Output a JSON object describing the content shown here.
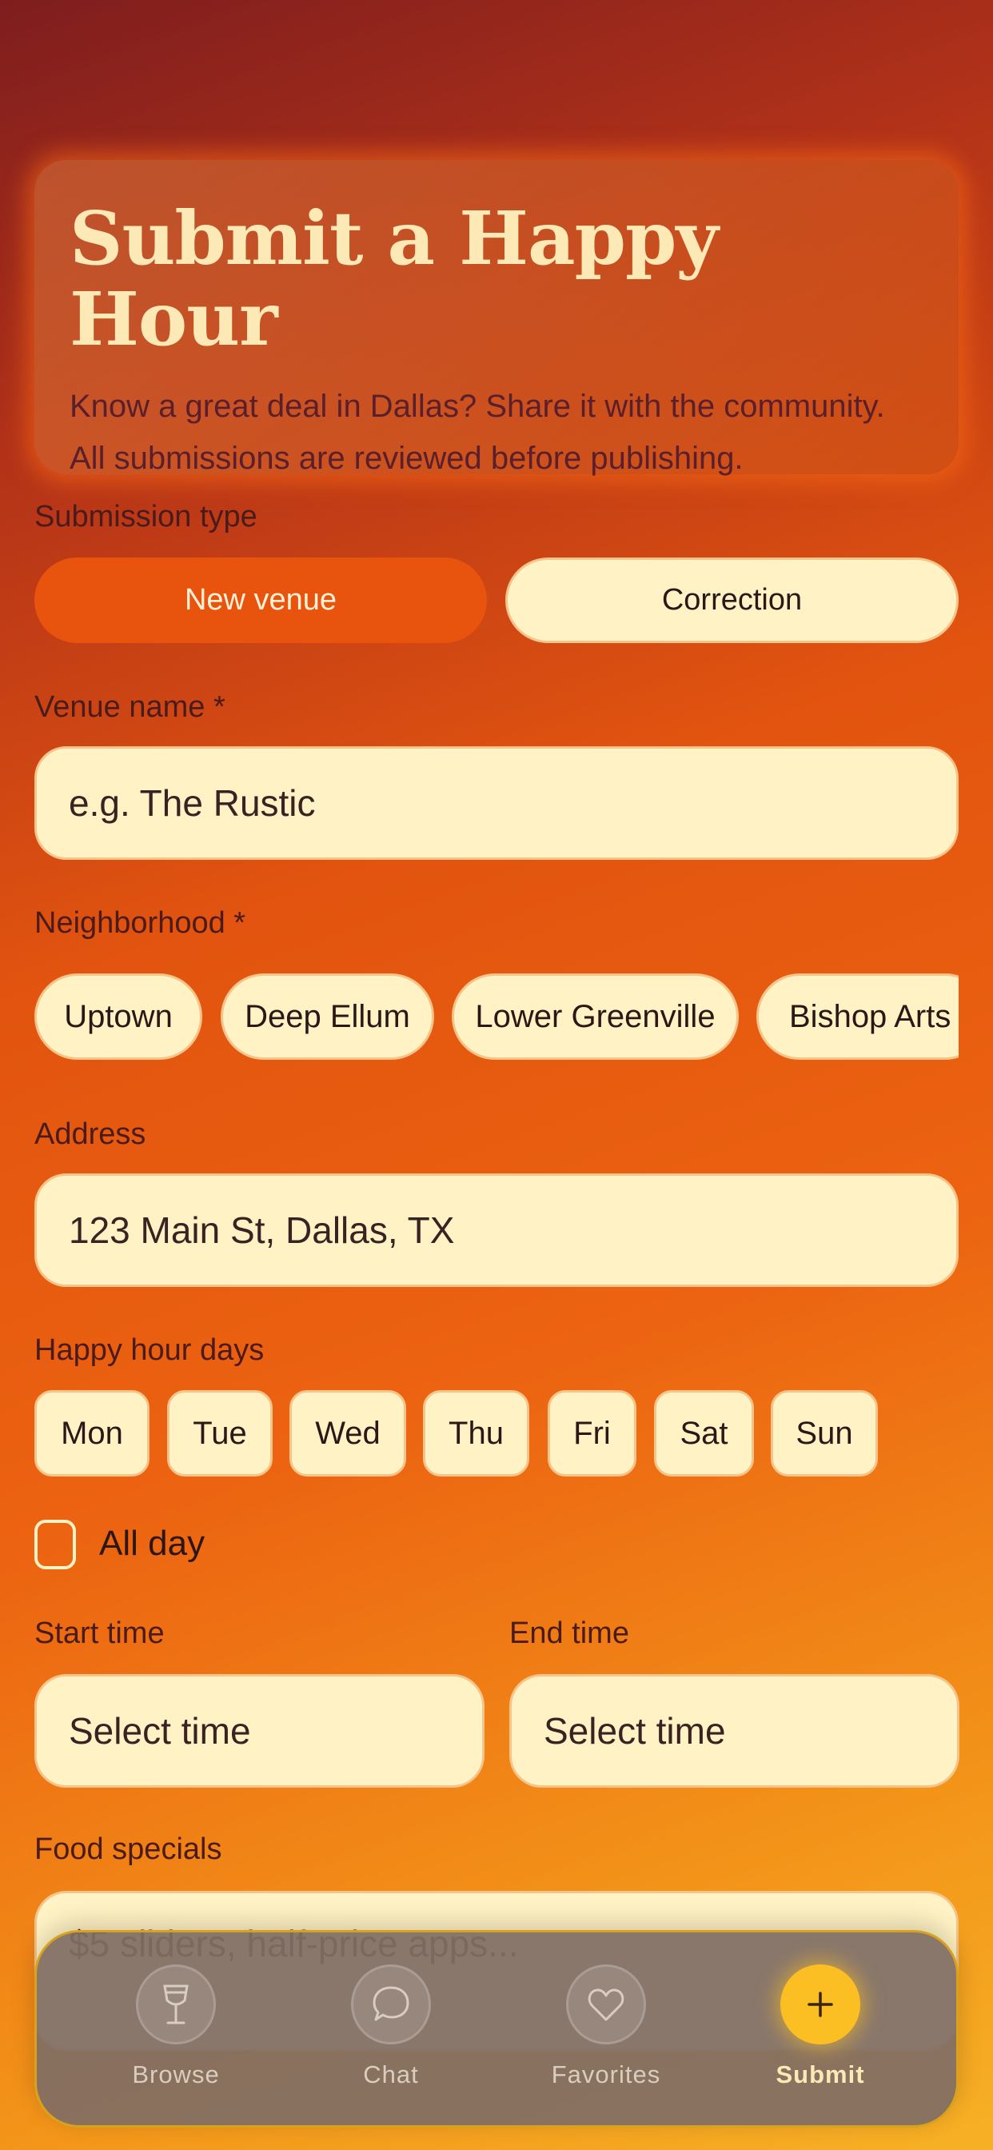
{
  "header": {
    "title": "Submit a Happy Hour",
    "subtitle_line1": "Know a great deal in Dallas? Share it with the community.",
    "subtitle_line2": "All submissions are reviewed before publishing."
  },
  "submission_type": {
    "label": "Submission type",
    "options": [
      "New venue",
      "Correction"
    ],
    "selected": "New venue"
  },
  "venue_name": {
    "label": "Venue name *",
    "placeholder": "e.g. The Rustic"
  },
  "neighborhood": {
    "label": "Neighborhood *",
    "options": [
      "Uptown",
      "Deep Ellum",
      "Lower Greenville",
      "Bishop Arts"
    ]
  },
  "address": {
    "label": "Address",
    "placeholder": "123 Main St, Dallas, TX"
  },
  "days": {
    "label": "Happy hour days",
    "options": [
      "Mon",
      "Tue",
      "Wed",
      "Thu",
      "Fri",
      "Sat",
      "Sun"
    ]
  },
  "all_day": {
    "label": "All day",
    "checked": false
  },
  "start_time": {
    "label": "Start time",
    "placeholder": "Select time"
  },
  "end_time": {
    "label": "End time",
    "placeholder": "Select time"
  },
  "food_specials": {
    "label": "Food specials",
    "placeholder": "$5 sliders, half-price apps..."
  },
  "nav": {
    "items": [
      {
        "label": "Browse",
        "icon": "wine-glass-icon"
      },
      {
        "label": "Chat",
        "icon": "chat-bubble-icon"
      },
      {
        "label": "Favorites",
        "icon": "heart-icon"
      },
      {
        "label": "Submit",
        "icon": "plus-icon",
        "active": true
      }
    ]
  },
  "colors": {
    "accent": "#e8540e",
    "field_bg": "#fff2c4",
    "title": "#fde9b5",
    "submit_active": "#fbbf24"
  }
}
